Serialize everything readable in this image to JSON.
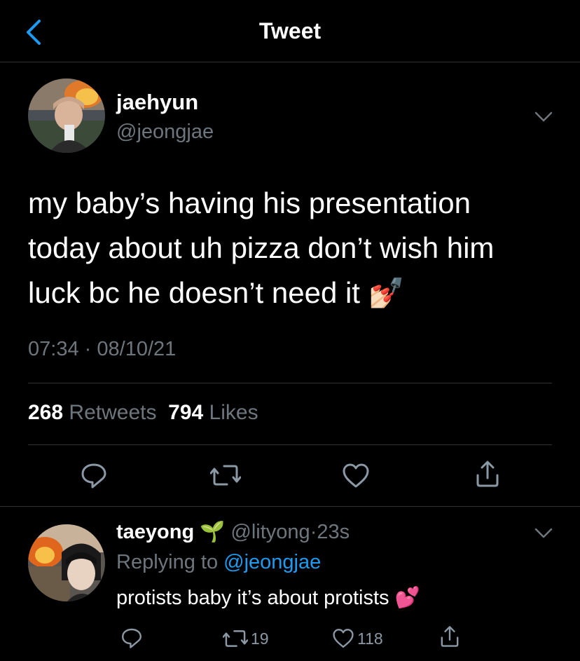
{
  "header": {
    "title": "Tweet",
    "back_icon": "chevron-left-icon"
  },
  "tweet": {
    "author_name": "jaehyun",
    "author_handle": "@jeongjae",
    "text_line1": "my baby’s having his presentation",
    "text_line2": "today about uh pizza don’t wish him",
    "text_line3": "luck bc he doesn’t need it",
    "emoji": "💅🏻",
    "time": "07:34",
    "separator": "·",
    "date": "08/10/21",
    "retweet_count": "268",
    "retweets_label": "Retweets",
    "like_count": "794",
    "likes_label": "Likes"
  },
  "reply": {
    "author_name": "taeyong",
    "name_emoji": "🌱",
    "author_handle": "@lityong",
    "separator": "·",
    "age": "23s",
    "replying_prefix": "Replying to",
    "replying_handle": "@jeongjae",
    "text": "protists baby it’s about protists",
    "emoji": "💕",
    "retweet_count": "19",
    "like_count": "118"
  },
  "colors": {
    "background": "#000000",
    "secondary_text": "#6e767d",
    "accent": "#1d9bf0",
    "divider": "#2f3336"
  }
}
